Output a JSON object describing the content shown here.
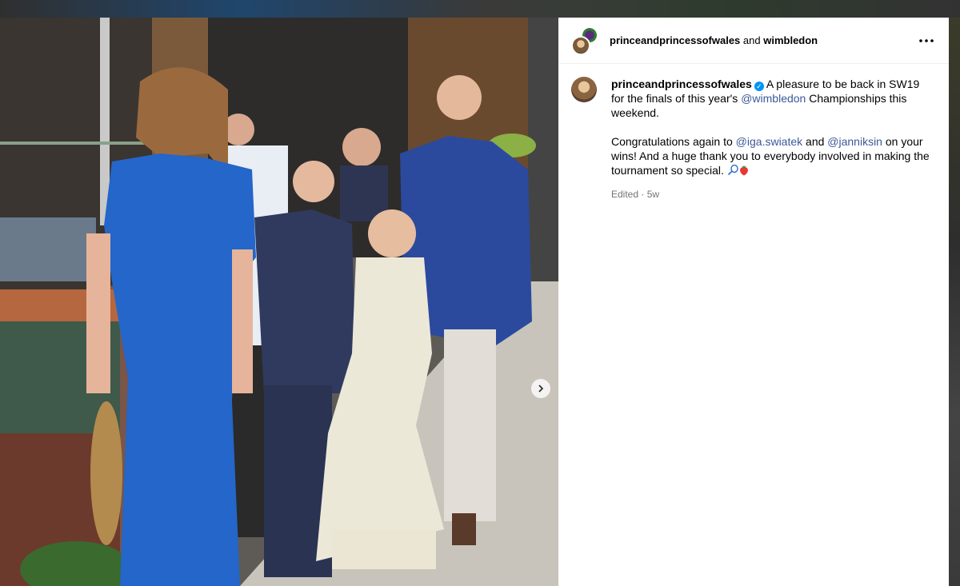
{
  "header": {
    "user1": "princeandprincessofwales",
    "conjunction": "and",
    "user2": "wimbledon",
    "more_icon": "more-horizontal-icon"
  },
  "caption": {
    "username": "princeandprincessofwales",
    "verified_icon": "verified-badge-icon",
    "text_part1": "A pleasure to be back in SW19 for the finals of this year's ",
    "mention1": "@wimbledon",
    "text_part2": " Championships this weekend.",
    "para2_part1": "Congratulations again to ",
    "mention2": "@iga.swiatek",
    "para2_part2": " and ",
    "mention3": "@janniksin",
    "para2_part3": " on your wins! And a huge thank you to everybody involved in making the tournament so special. ",
    "emojis": [
      "tennis-racket-icon",
      "strawberry-icon"
    ],
    "edited_label": "Edited",
    "separator": " · ",
    "time_ago": "5w"
  },
  "photo": {
    "description_icon": "post-photo",
    "next_icon": "chevron-right-icon"
  },
  "colors": {
    "mention": "#3b5998",
    "verified": "#0095f6",
    "meta_text": "#737373"
  }
}
